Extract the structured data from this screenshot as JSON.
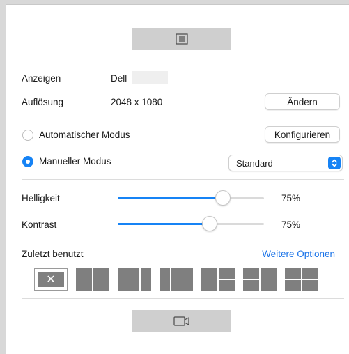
{
  "toolbar": {
    "top_icon": "list-icon",
    "bottom_icon": "video-camera-icon"
  },
  "display": {
    "label": "Anzeigen",
    "value": "Dell",
    "resolution_label": "Auflösung",
    "resolution_value": "2048 x 1080",
    "change_button": "Ändern"
  },
  "modes": {
    "auto_label": "Automatischer Modus",
    "auto_selected": false,
    "configure_button": "Konfigurieren",
    "manual_label": "Manueller Modus",
    "manual_selected": true,
    "preset_value": "Standard"
  },
  "adjustments": {
    "brightness_label": "Helligkeit",
    "brightness_value": "75%",
    "brightness_level": 0.72,
    "contrast_label": "Kontrast",
    "contrast_value": "75%",
    "contrast_level": 0.63
  },
  "recent": {
    "label": "Zuletzt benutzt",
    "more_options": "Weitere Optionen",
    "clear_symbol": "✕",
    "layouts": [
      "two-columns",
      "wide-left-narrow-right",
      "narrow-left-wide-right",
      "left-full-right-split",
      "left-split-right-full",
      "quad-grid"
    ]
  },
  "colors": {
    "accent": "#1683f5",
    "link": "#1a73e8",
    "tile": "#7f7f7f",
    "button_bg": "#cfcfcf"
  }
}
